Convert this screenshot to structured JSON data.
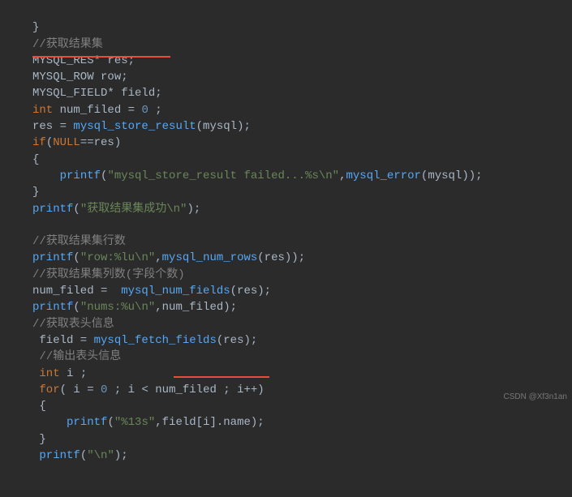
{
  "code": {
    "l1": "}",
    "l2a": "//",
    "l2b": "获取结果集",
    "l3a": "MYSQL_RES* res;",
    "l4a": "MYSQL_ROW row;",
    "l5a": "MYSQL_FIELD* field;",
    "l6a": "int",
    "l6b": " num_filed = ",
    "l6c": "0",
    "l6d": " ;",
    "l7a": "res = ",
    "l7b": "mysql_store_result",
    "l7c": "(mysql);",
    "l8a": "if",
    "l8b": "(",
    "l8c": "NULL",
    "l8d": "==res)",
    "l9a": "{",
    "l10a": "    ",
    "l10b": "printf",
    "l10c": "(",
    "l10d": "\"mysql_store_result failed...%s\\n\"",
    "l10e": ",",
    "l10f": "mysql_error",
    "l10g": "(mysql));",
    "l11a": "}",
    "l12a": "printf",
    "l12b": "(",
    "l12c": "\"获取结果集成功\\n\"",
    "l12d": ");",
    "l14a": "//",
    "l14b": "获取结果集行数",
    "l15a": "printf",
    "l15b": "(",
    "l15c": "\"row:%lu\\n\"",
    "l15d": ",",
    "l15e": "mysql_num_rows",
    "l15f": "(res));",
    "l16a": "//",
    "l16b": "获取结果集列数(字段个数)",
    "l17a": "num_filed =  ",
    "l17b": "mysql_num_fields",
    "l17c": "(res);",
    "l18a": "printf",
    "l18b": "(",
    "l18c": "\"nums:%u\\n\"",
    "l18d": ",num_filed);",
    "l19a": "//",
    "l19b": "获取表头信息",
    "l20a": " field = ",
    "l20b": "mysql_fetch_fields",
    "l20c": "(res);",
    "l21a": " //",
    "l21b": "输出表头信息",
    "l22a": " ",
    "l22b": "int",
    "l22c": " i ;",
    "l23a": " ",
    "l23b": "for",
    "l23c": "( i = ",
    "l23d": "0",
    "l23e": " ; i < num_filed ; i++)",
    "l24a": " {",
    "l25a": "     ",
    "l25b": "printf",
    "l25c": "(",
    "l25d": "\"%13s\"",
    "l25e": ",field[i].name);",
    "l26a": " }",
    "l27a": " ",
    "l27b": "printf",
    "l27c": "(",
    "l27d": "\"\\n\"",
    "l27e": ");"
  },
  "watermark": "CSDN @Xf3n1an"
}
